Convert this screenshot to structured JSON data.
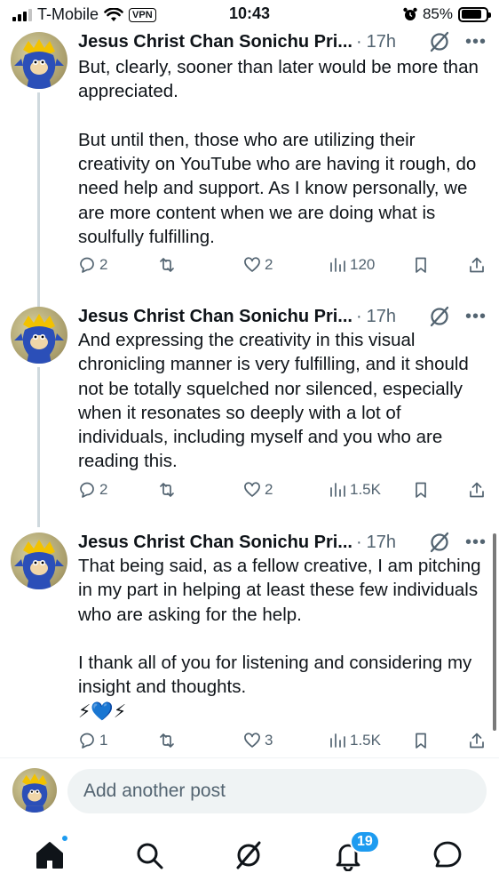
{
  "status_bar": {
    "carrier": "T-Mobile",
    "vpn": "VPN",
    "time": "10:43",
    "battery": "85%",
    "battery_level": 0.85
  },
  "posts": [
    {
      "author": "Jesus Christ Chan Sonichu Pri...",
      "time_separator": "·",
      "time": "17h",
      "more": "•••",
      "text": "But, clearly, sooner than later would be more than appreciated.\n\nBut until then, those who are utilizing their creativity on YouTube who are having it rough, do need help and support. As I know personally, we are more content when we are doing what is soulfully fulfilling.",
      "replies": "2",
      "reposts": "",
      "likes": "2",
      "views": "120"
    },
    {
      "author": "Jesus Christ Chan Sonichu Pri...",
      "time_separator": "·",
      "time": "17h",
      "more": "•••",
      "text": "And expressing the creativity in this visual chronicling manner is very fulfilling, and it should not be totally squelched nor silenced, especially when it resonates so deeply with a lot of individuals, including myself and you who are reading this.",
      "replies": "2",
      "reposts": "",
      "likes": "2",
      "views": "1.5K"
    },
    {
      "author": "Jesus Christ Chan Sonichu Pri...",
      "time_separator": "·",
      "time": "17h",
      "more": "•••",
      "text": "That being said, as a fellow creative, I am pitching in my part in helping at least these few individuals who are asking for the help.\n\nI thank all of you for listening and considering my insight and thoughts.\n⚡💙⚡",
      "replies": "1",
      "reposts": "",
      "likes": "3",
      "views": "1.5K"
    }
  ],
  "composer": {
    "placeholder": "Add another post"
  },
  "tab_bar": {
    "notifications_badge": "19"
  },
  "colors": {
    "accent": "#1d9bf0",
    "text": "#0f1419",
    "secondary": "#536471",
    "thread_line": "#cfd9de"
  }
}
